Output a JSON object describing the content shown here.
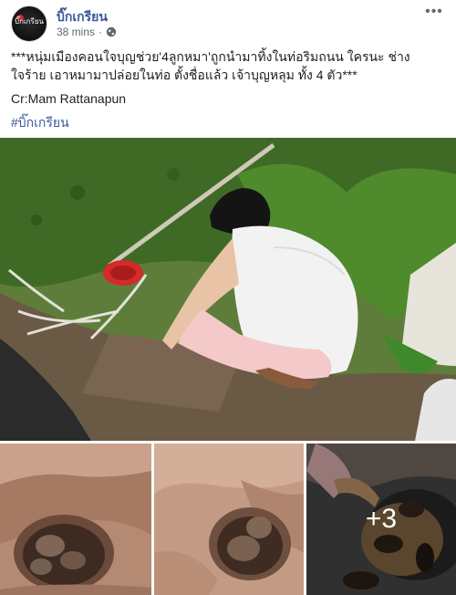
{
  "post": {
    "page_name": "บิ๊กเกรียน",
    "avatar_label": "บิ๊กเกรียน",
    "timestamp": "38 mins",
    "separator": "·",
    "privacy_icon": "globe-icon",
    "more_icon": "ellipsis-icon",
    "text_line_1": "***หนุ่มเมืองคอนใจบุญช่วย'4ลูกหมา'ถูกนำมาทิ้งในท่อริมถนน ใครนะ ช่างใจร้าย เอาหมามาปล่อยในท่อ ตั้งชื่อแล้ว เจ้าบุญหลุม ทั้ง 4 ตัว***",
    "credit": "Cr:Mam Rattanapun",
    "hashtag": "#บิ๊กเกรียน"
  },
  "photos": {
    "main_alt": "man crouching by roadside drain",
    "thumb_1_alt": "puppies in drain pipe",
    "thumb_2_alt": "puppy in drain pipe",
    "thumb_3_alt": "puppies being fed",
    "more_count": "+3"
  },
  "colors": {
    "link": "#385898",
    "meta": "#616770",
    "text": "#1c1e21"
  }
}
